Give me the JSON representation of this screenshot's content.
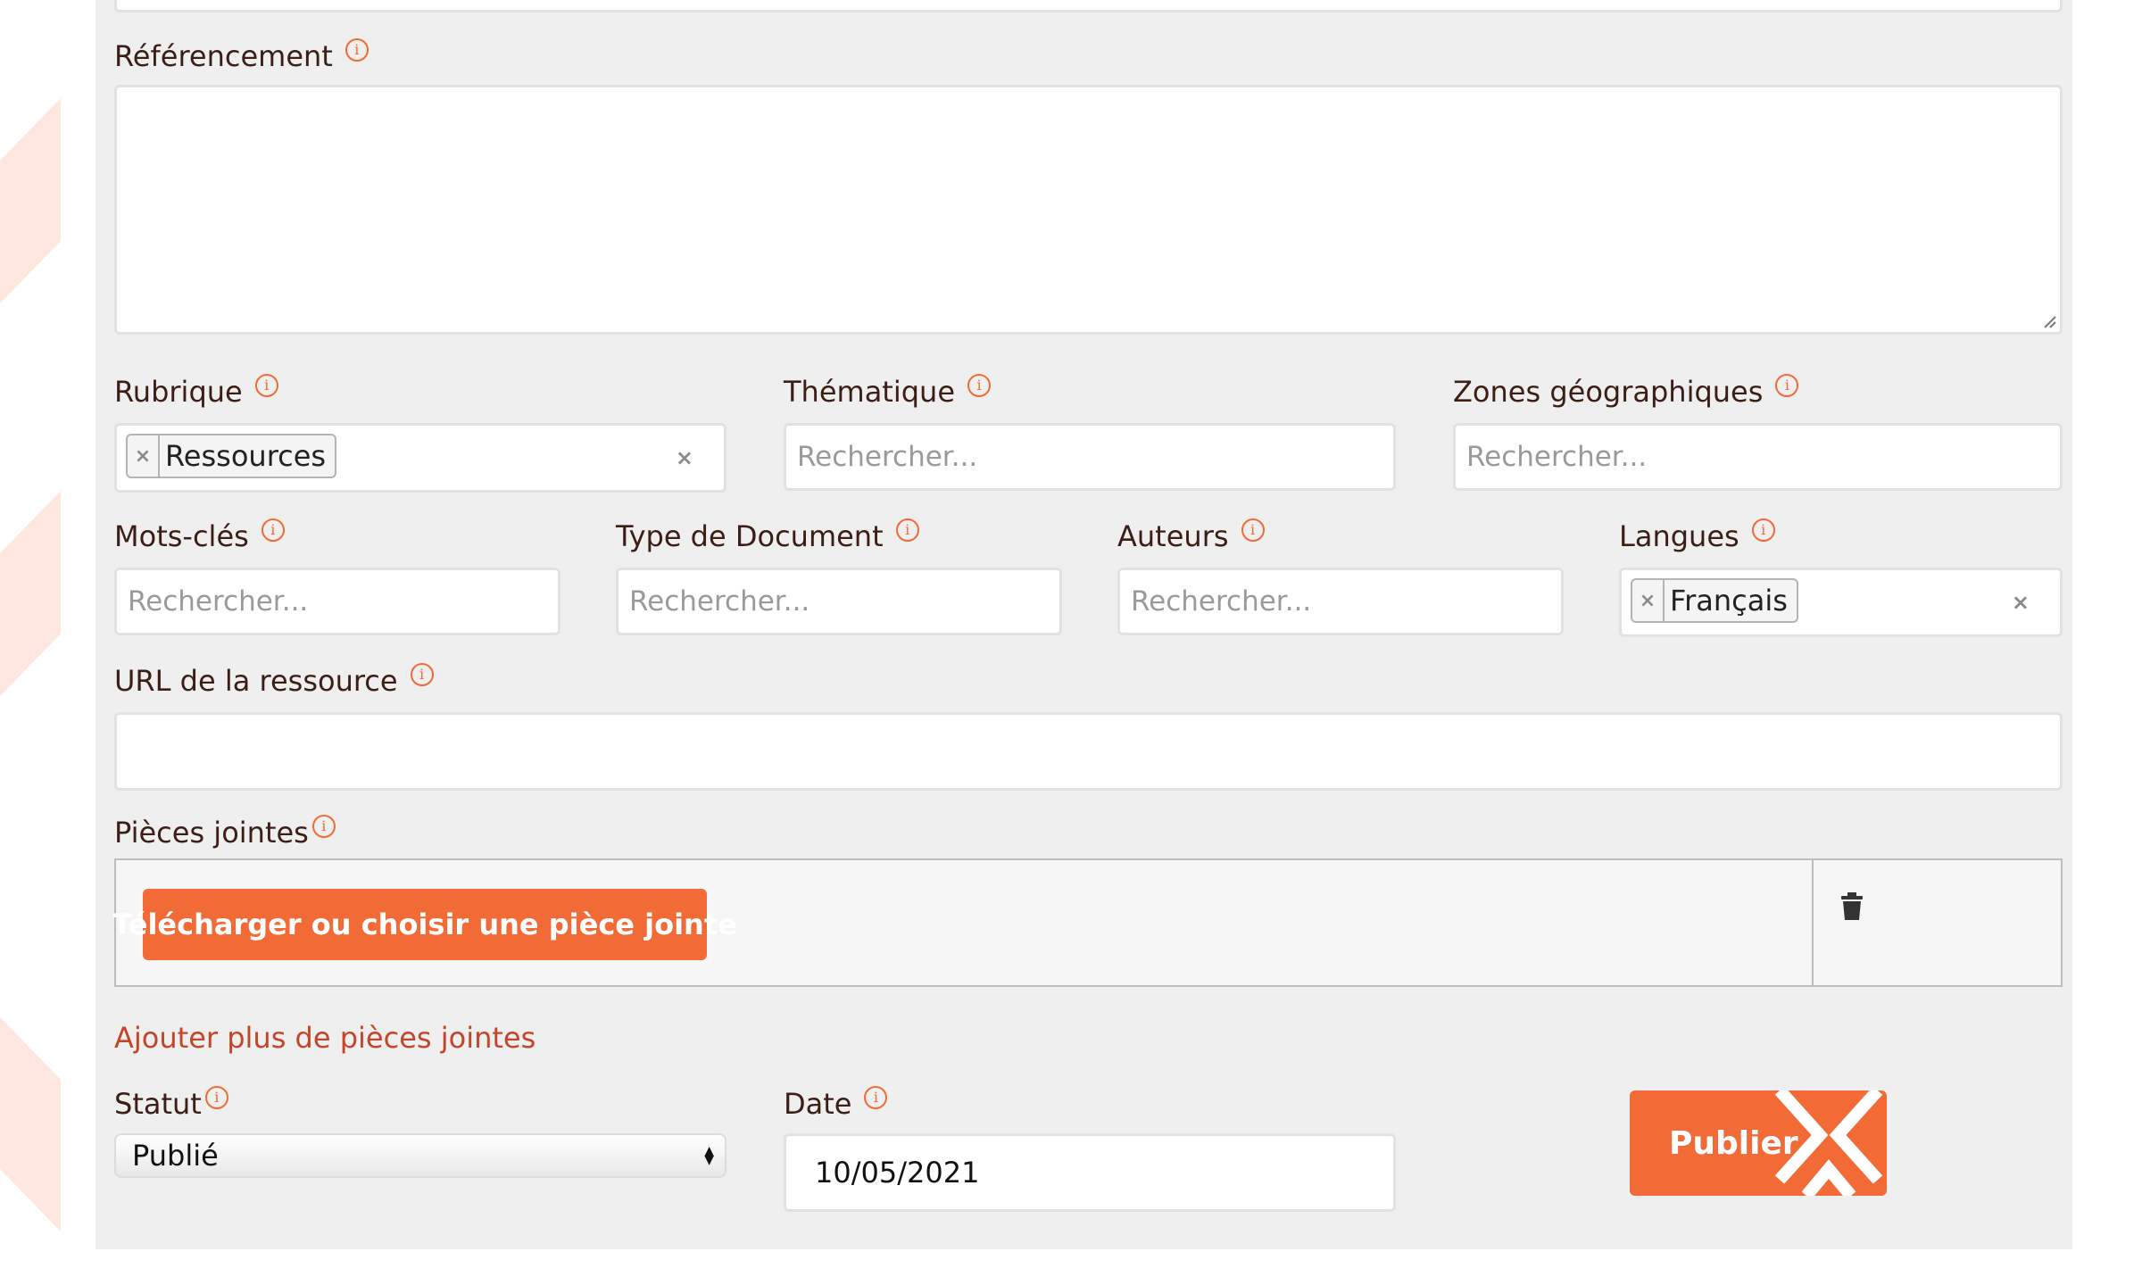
{
  "form": {
    "referencement": {
      "label": "Référencement",
      "value": ""
    },
    "rubrique": {
      "label": "Rubrique",
      "tag": "Ressources"
    },
    "thematique": {
      "label": "Thématique",
      "placeholder": "Rechercher..."
    },
    "zones": {
      "label": "Zones géographiques",
      "placeholder": "Rechercher..."
    },
    "mots_cles": {
      "label": "Mots-clés",
      "placeholder": "Rechercher..."
    },
    "type_document": {
      "label": "Type de Document",
      "placeholder": "Rechercher..."
    },
    "auteurs": {
      "label": "Auteurs",
      "placeholder": "Rechercher..."
    },
    "langues": {
      "label": "Langues",
      "tag": "Français"
    },
    "url": {
      "label": "URL de la ressource",
      "value": ""
    },
    "pieces_jointes": {
      "label": "Pièces jointes",
      "upload_button": "Télécharger ou choisir une pièce jointe",
      "add_more": "Ajouter plus de pièces jointes"
    },
    "statut": {
      "label": "Statut",
      "value": "Publié"
    },
    "date": {
      "label": "Date",
      "value": "10/05/2021"
    },
    "publish_button": "Publier"
  },
  "icons": {
    "info": "info-icon",
    "remove": "×",
    "delete": "trash-icon"
  },
  "colors": {
    "accent": "#f26a36",
    "link": "#c4452a",
    "panel_bg": "#efefef"
  }
}
